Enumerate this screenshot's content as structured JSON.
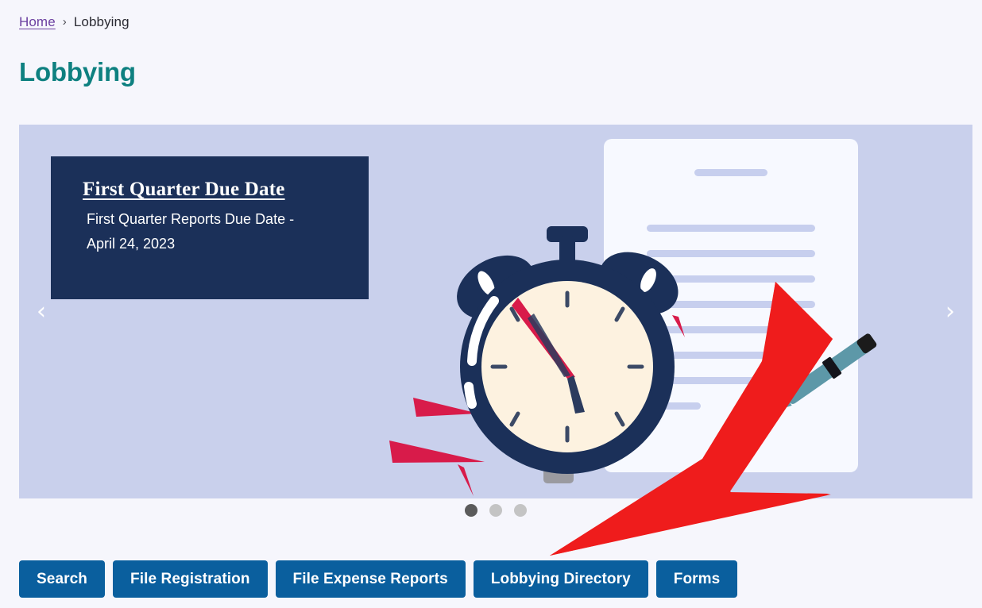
{
  "breadcrumb": {
    "home_label": "Home",
    "separator": "›",
    "current_label": "Lobbying"
  },
  "page": {
    "title": "Lobbying",
    "title_color": "#0e8080",
    "background_color": "#f6f6fc"
  },
  "hero": {
    "background_color": "#c9d0ec",
    "card": {
      "background_color": "#1b3059",
      "title": "First Quarter Due Date",
      "body": "First Quarter Reports Due Date - April 24, 2023"
    },
    "prev_arrow": "‹",
    "next_arrow": "›",
    "dots": [
      {
        "active": true
      },
      {
        "active": false
      },
      {
        "active": false
      }
    ],
    "illustration": {
      "description": "alarm clock in front of a document with a pen",
      "clock_body_color": "#1b3059",
      "clock_face_color": "#fdf2e0",
      "clock_hand_color": "#d81b4a",
      "bell_handle_color": "#9a9aa0",
      "document_color": "#f7f9ff",
      "document_line_color": "#c7cfee",
      "pen_color": "#5d98a8",
      "spark_color": "#d81b4a"
    }
  },
  "annotation": {
    "arrow_color": "#ef1c1c",
    "points_to": "Lobbying Directory"
  },
  "buttons": [
    {
      "label": "Search",
      "name": "search-button"
    },
    {
      "label": "File Registration",
      "name": "file-registration-button"
    },
    {
      "label": "File Expense Reports",
      "name": "file-expense-reports-button"
    },
    {
      "label": "Lobbying Directory",
      "name": "lobbying-directory-button"
    },
    {
      "label": "Forms",
      "name": "forms-button"
    }
  ]
}
